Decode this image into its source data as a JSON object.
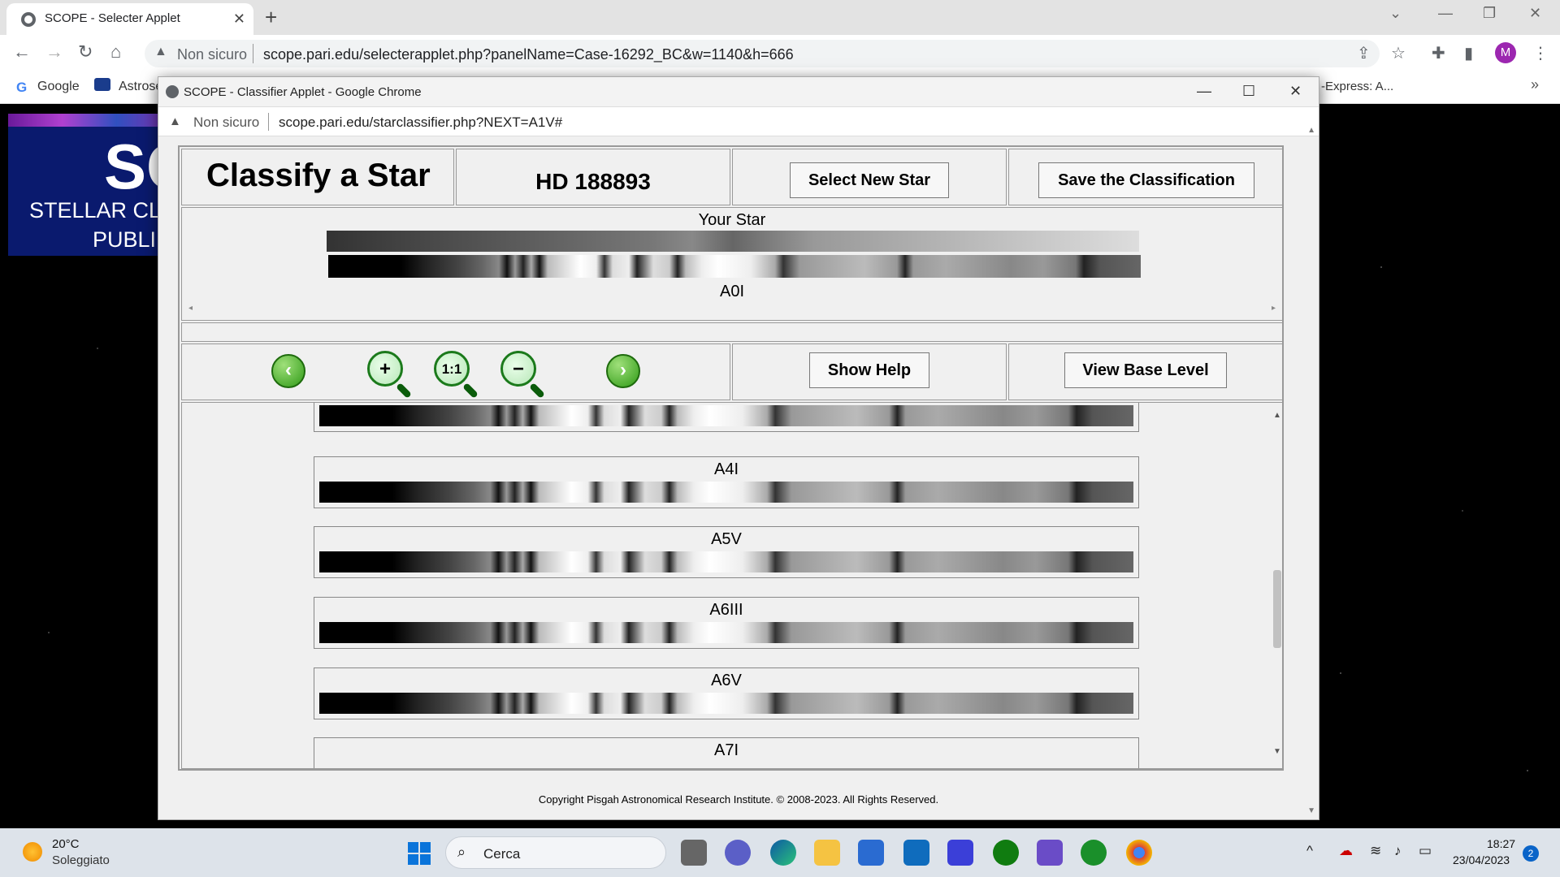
{
  "browser": {
    "tab_title": "SCOPE - Selecter Applet",
    "not_secure": "Non sicuro",
    "url": "scope.pari.edu/selecterapplet.php?panelName=Case-16292_BC&w=1140&h=666",
    "avatar_initial": "M",
    "bookmarks": [
      "Google",
      "Astrose"
    ],
    "bookmark_right": "-Express: A...",
    "icons": {
      "back": "arrow-left-icon",
      "forward": "arrow-right-icon",
      "reload": "reload-icon",
      "home": "home-icon"
    }
  },
  "background_page": {
    "logo_big": "SC",
    "logo_line1": "STELLAR CL",
    "logo_line2": "PUBLI"
  },
  "popup": {
    "window_title": "SCOPE - Classifier Applet - Google Chrome",
    "not_secure": "Non sicuro",
    "url": "scope.pari.edu/starclassifier.php?NEXT=A1V#"
  },
  "applet": {
    "title": "Classify a Star",
    "star_name": "HD 188893",
    "select_new_star": "Select New Star",
    "save_classification": "Save the Classification",
    "your_star_label": "Your Star",
    "your_star_match": "A0I",
    "show_help": "Show Help",
    "view_base_level": "View Base Level",
    "reference_spectra": [
      "A4I",
      "A5V",
      "A6III",
      "A6V",
      "A7I"
    ],
    "copyright": "Copyright Pisgah Astronomical Research Institute.  © 2008-2023.  All Rights Reserved."
  },
  "taskbar": {
    "temp": "20°C",
    "condition": "Soleggiato",
    "search": "Cerca",
    "time": "18:27",
    "date": "23/04/2023",
    "notifications": "2"
  }
}
